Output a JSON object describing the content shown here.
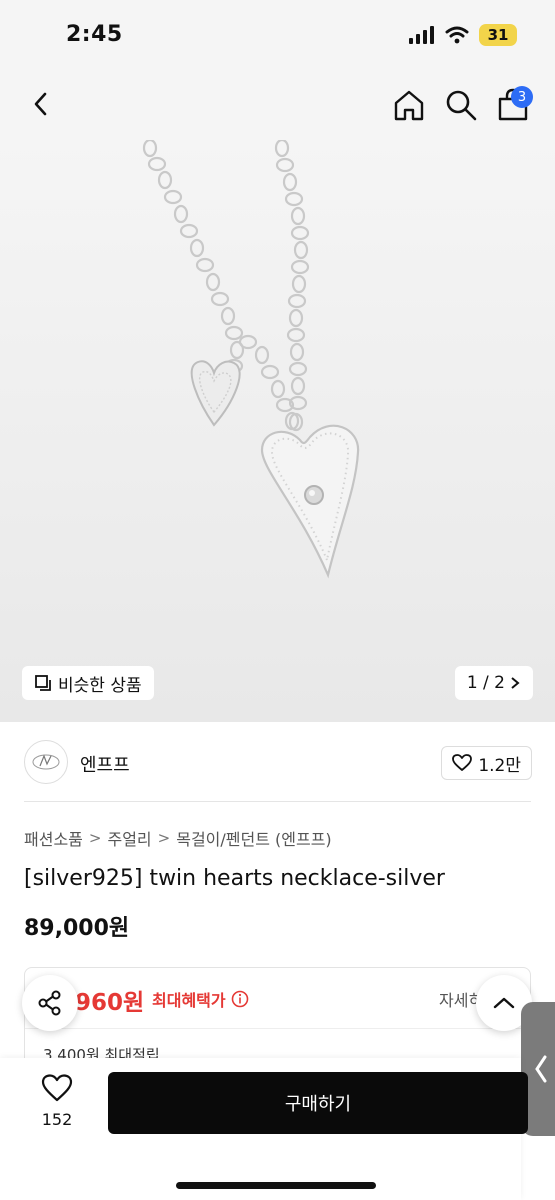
{
  "status_bar": {
    "time": "2:45",
    "battery": "31"
  },
  "nav": {
    "cart_count": "3",
    "icons": [
      "back-arrow-icon",
      "home-icon",
      "search-icon",
      "shopping-bag-icon"
    ]
  },
  "hero": {
    "similar_label": "비슷한 상품",
    "page_indicator": "1 / 2"
  },
  "brand": {
    "name": "엔프프",
    "likes": "1.2만"
  },
  "breadcrumb": [
    "패션소품",
    "주얼리",
    "목걸이/펜던트 (엔프프)"
  ],
  "product": {
    "title": "[silver925] twin hearts necklace-silver",
    "price": "89,000원"
  },
  "benefit": {
    "price": "960원",
    "label": "최대혜택가",
    "detail": "자세히",
    "points": "3,400원 최대적립"
  },
  "bottom": {
    "wish_count": "152",
    "buy_label": "구매하기"
  },
  "colors": {
    "accent_red": "#e53935",
    "badge_blue": "#2d6cf5",
    "buy_button": "#0a0a0a"
  }
}
